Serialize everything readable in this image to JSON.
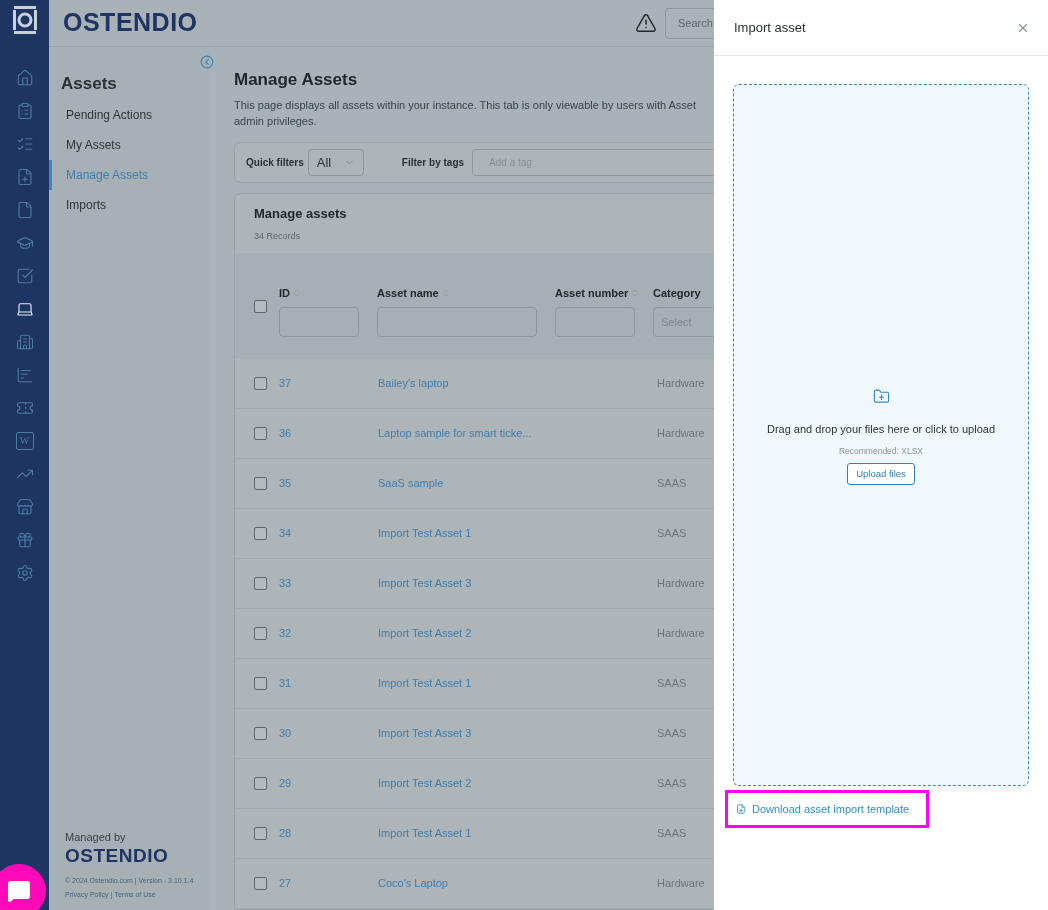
{
  "rail": [
    {
      "kind": "home",
      "selected": false
    },
    {
      "kind": "clipboard",
      "selected": false
    },
    {
      "kind": "checklist",
      "selected": false
    },
    {
      "kind": "file-plus",
      "selected": false
    },
    {
      "kind": "file",
      "selected": false
    },
    {
      "kind": "graduation",
      "selected": false
    },
    {
      "kind": "check-square",
      "selected": false
    },
    {
      "kind": "laptop",
      "selected": true
    },
    {
      "kind": "building",
      "selected": false
    },
    {
      "kind": "chart",
      "selected": false
    },
    {
      "kind": "ticket",
      "selected": false
    },
    {
      "kind": "wiki",
      "glyph": "W",
      "selected": false
    },
    {
      "kind": "trend",
      "selected": false
    },
    {
      "kind": "store",
      "selected": false
    },
    {
      "kind": "gift",
      "selected": false
    },
    {
      "kind": "settings",
      "selected": false
    }
  ],
  "header": {
    "logo": "OSTENDIO",
    "search_placeholder": "Search"
  },
  "sidebar": {
    "title": "Assets",
    "items": [
      {
        "label": "Pending Actions",
        "selected": false
      },
      {
        "label": "My Assets",
        "selected": false
      },
      {
        "label": "Manage Assets",
        "selected": true
      },
      {
        "label": "Imports",
        "selected": false
      }
    ],
    "managed_by": "Managed by",
    "managed_logo": "OSTENDIO",
    "footer": "© 2024 Ostendio.com | Version - 3.10.1.4",
    "privacy": "Privacy Policy",
    "separator": "|",
    "terms": "Terms of Use"
  },
  "page": {
    "title": "Manage Assets",
    "description": "This page displays all assets within your instance. This tab is only viewable by users with Asset admin privileges.",
    "quick_filters_label": "Quick filters",
    "quick_filter_value": "All",
    "tags_label": "Filter by tags",
    "tags_placeholder": "Add a tag"
  },
  "table": {
    "title": "Manage assets",
    "count": "34 Records",
    "select_all_checked": false,
    "columns": [
      {
        "label": "ID",
        "sortable": true,
        "kind": "input"
      },
      {
        "label": "Asset name",
        "sortable": true,
        "kind": "input"
      },
      {
        "label": "Asset number",
        "sortable": true,
        "kind": "input"
      },
      {
        "label": "Category",
        "sortable": false,
        "kind": "select",
        "placeholder": "Select"
      }
    ],
    "rows": [
      {
        "id": "37",
        "name": "Bailey's laptop",
        "category": "Hardware",
        "checked": false
      },
      {
        "id": "36",
        "name": "Laptop sample for smart ticke...",
        "category": "Hardware",
        "checked": false
      },
      {
        "id": "35",
        "name": "SaaS sample",
        "category": "SAAS",
        "checked": false
      },
      {
        "id": "34",
        "name": "Import Test Asset 1",
        "category": "SAAS",
        "checked": false
      },
      {
        "id": "33",
        "name": "Import Test Asset 3",
        "category": "Hardware",
        "checked": false
      },
      {
        "id": "32",
        "name": "Import Test Asset 2",
        "category": "Hardware",
        "checked": false
      },
      {
        "id": "31",
        "name": "Import Test Asset 1",
        "category": "SAAS",
        "checked": false
      },
      {
        "id": "30",
        "name": "Import Test Asset 3",
        "category": "SAAS",
        "checked": false
      },
      {
        "id": "29",
        "name": "Import Test Asset 2",
        "category": "SAAS",
        "checked": false
      },
      {
        "id": "28",
        "name": "Import Test Asset 1",
        "category": "SAAS",
        "checked": false
      },
      {
        "id": "27",
        "name": "Coco's Laptop",
        "category": "Hardware",
        "checked": false
      }
    ]
  },
  "drawer": {
    "title": "Import asset",
    "drop_text": "Drag and drop your files here or click to upload",
    "recommended": "Recommended: XLSX",
    "upload_button": "Upload files",
    "download_link": "Download asset import template",
    "highlighted": true
  }
}
